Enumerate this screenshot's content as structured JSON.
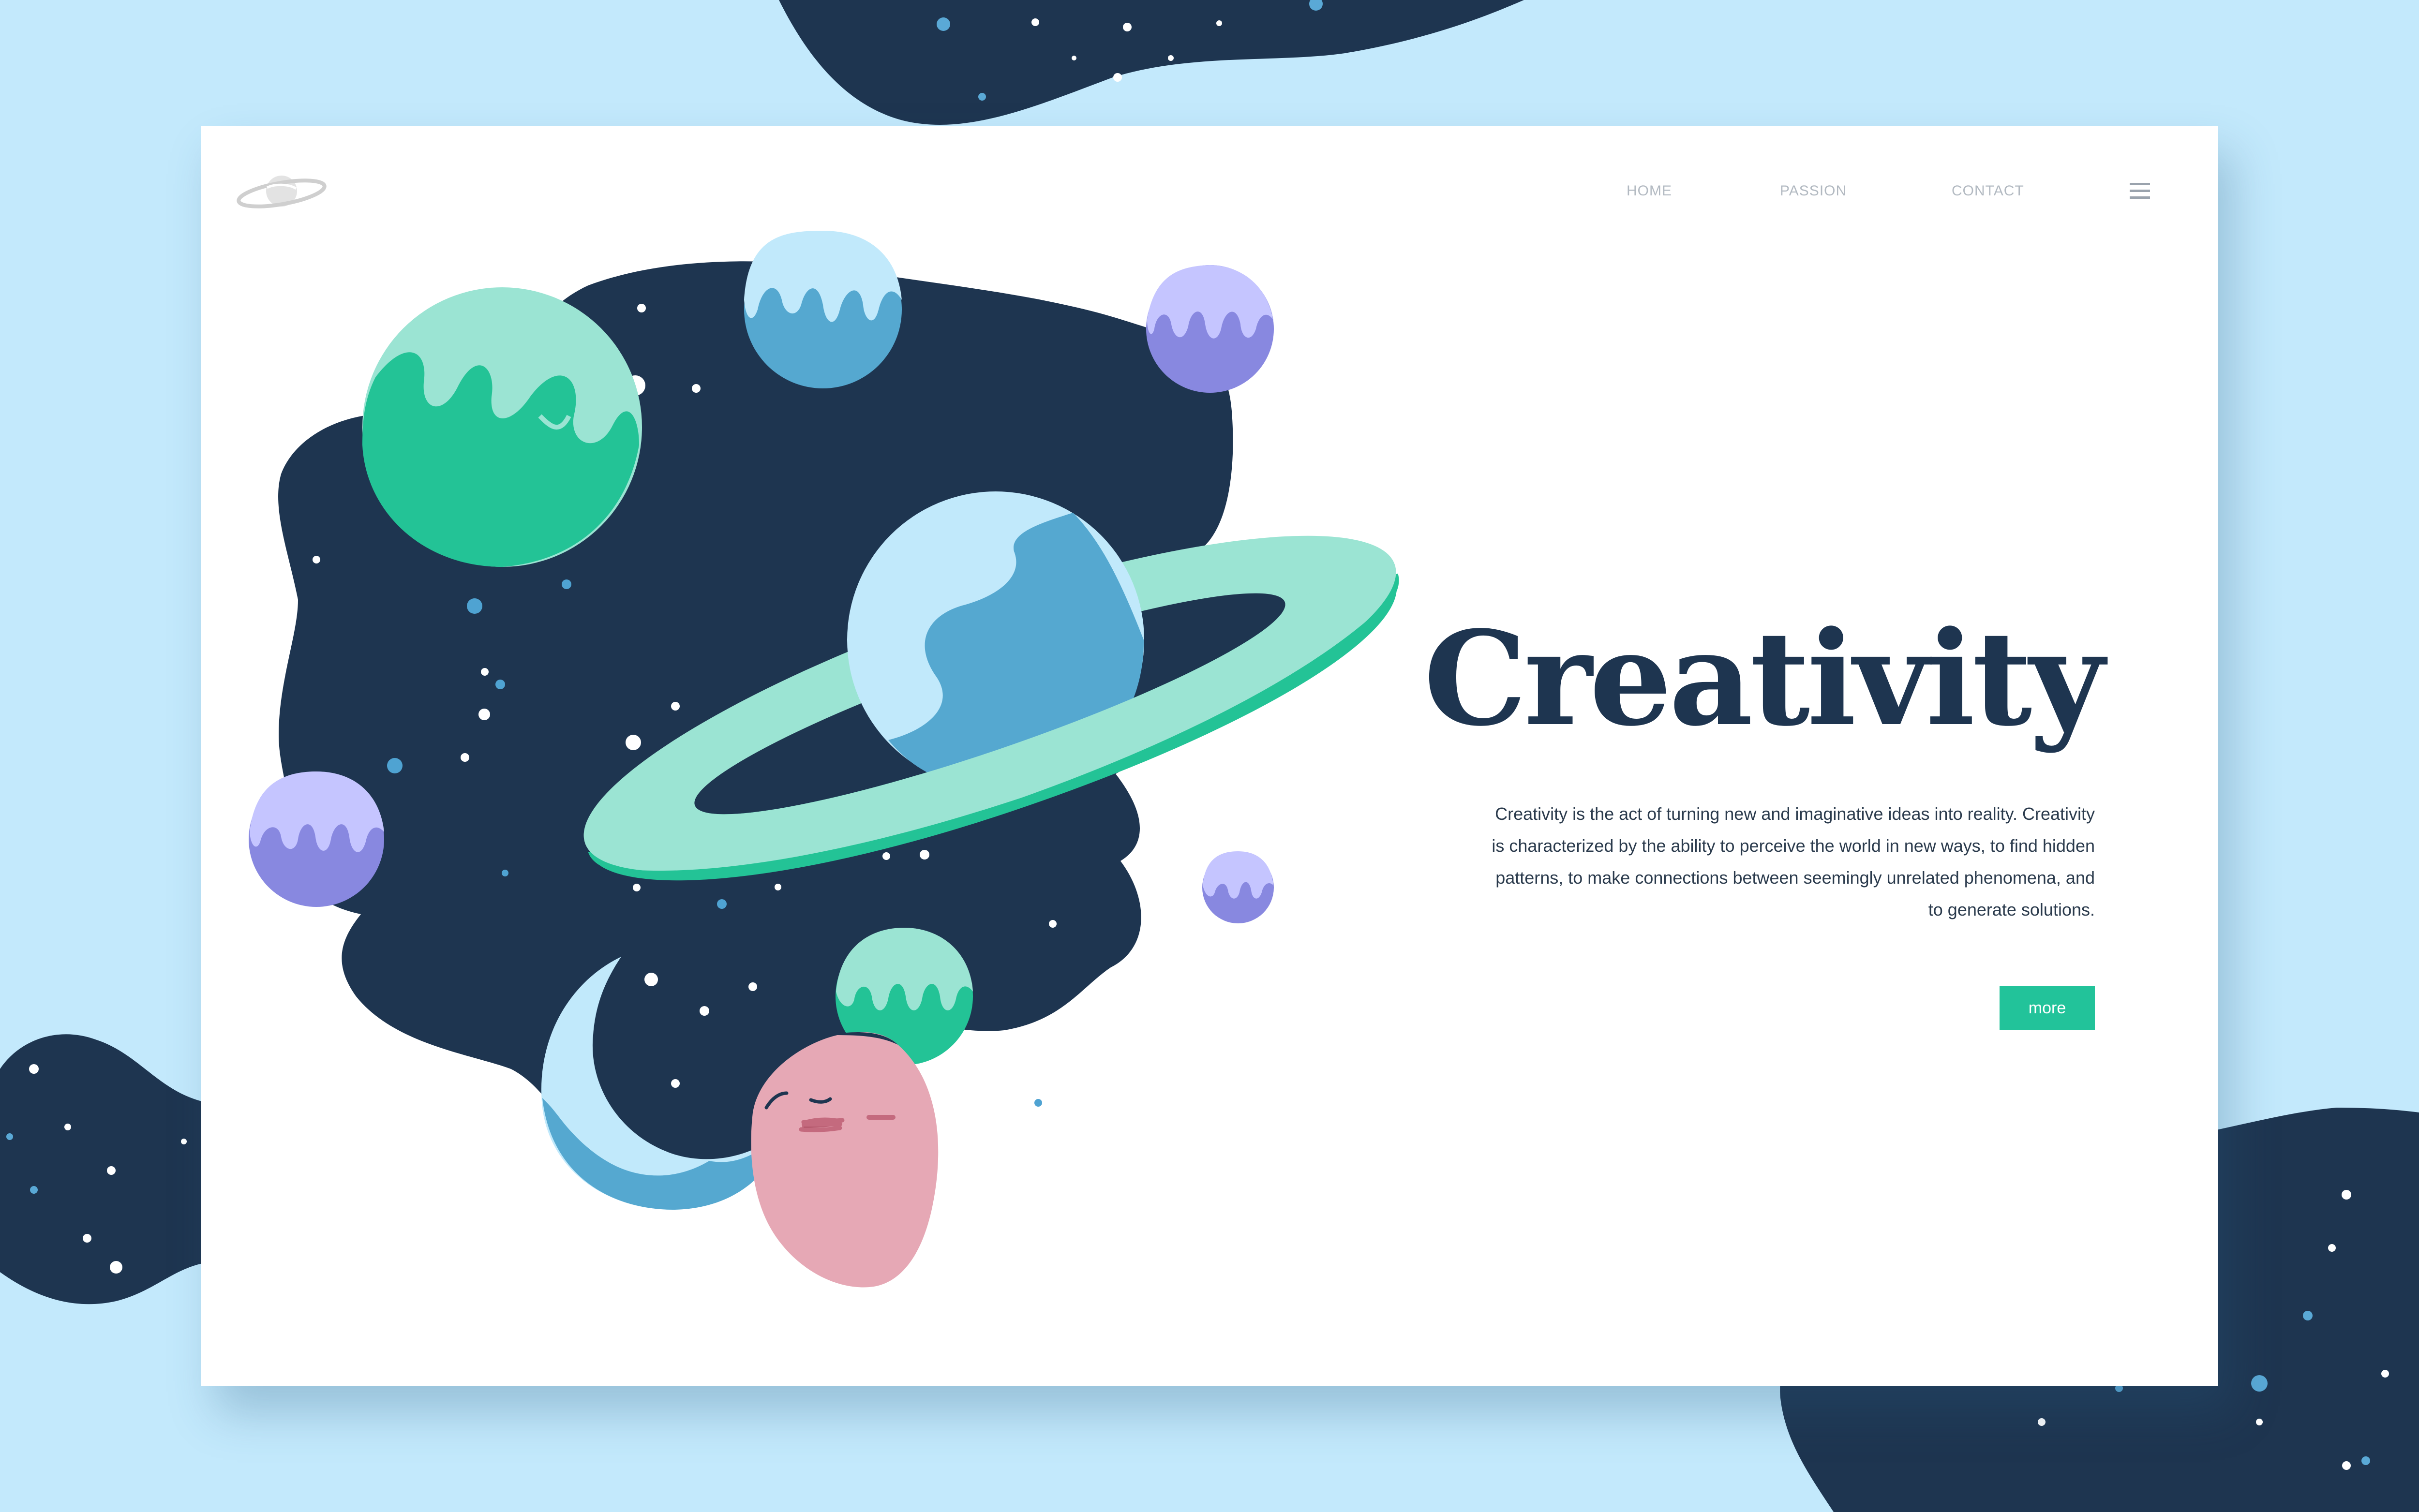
{
  "page": {
    "background_color": "#c3e9fc",
    "space_color": "#1e3550",
    "accent_color": "#22c39a"
  },
  "header": {
    "logo_icon": "saturn-logo-icon",
    "nav": {
      "home": "HOME",
      "passion": "PASSION",
      "contact": "CONTACT"
    },
    "menu_icon": "hamburger-menu-icon"
  },
  "hero": {
    "title": "Creativity",
    "description": "Creativity is the act of turning new and imaginative ideas into reality. Creativity is characterized by the ability to perceive the world in new ways, to find hidden patterns, to make connections between seemingly unrelated phenomena, and to generate solutions.",
    "more_label": "more",
    "illustration": "woman-with-space-hair-illustration"
  }
}
